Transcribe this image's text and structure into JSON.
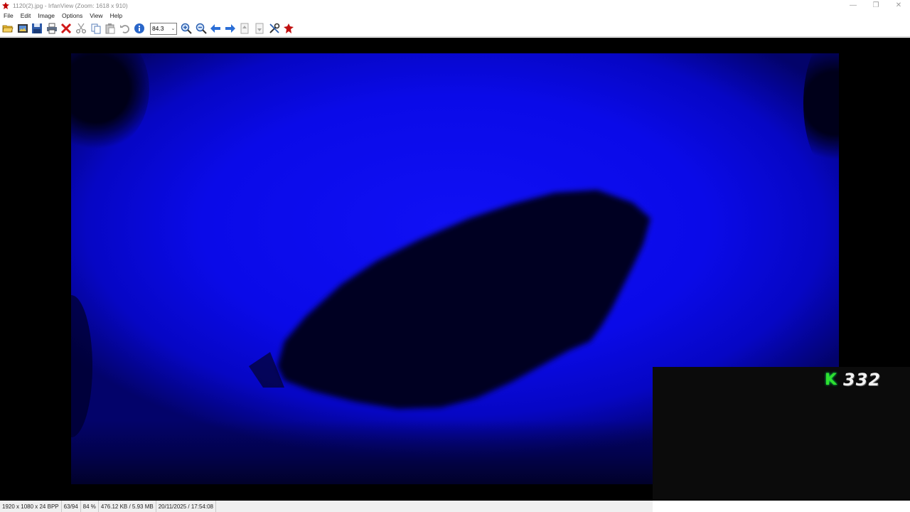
{
  "window": {
    "title": "1120(2).jpg - IrfanView (Zoom: 1618 x 910)",
    "minimize_glyph": "—",
    "restore_glyph": "❐",
    "close_glyph": "✕"
  },
  "menu": {
    "items": [
      {
        "label": "File"
      },
      {
        "label": "Edit"
      },
      {
        "label": "Image"
      },
      {
        "label": "Options"
      },
      {
        "label": "View"
      },
      {
        "label": "Help"
      }
    ]
  },
  "toolbar": {
    "zoom_value": "84.3",
    "zoom_arrow": "⌄",
    "icons": [
      "open-folder-icon",
      "slideshow-icon",
      "save-icon",
      "print-icon",
      "delete-icon",
      "cut-icon",
      "copy-icon",
      "paste-icon",
      "undo-icon",
      "info-icon",
      "zoom-in-icon",
      "zoom-out-icon",
      "previous-icon",
      "next-icon",
      "first-page-icon",
      "last-page-icon",
      "settings-icon",
      "exit-icon"
    ]
  },
  "overlay": {
    "prefix": "K",
    "number": "332"
  },
  "status": {
    "dimensions": "1920 x 1080 x 24 BPP",
    "index": "63/94",
    "zoom": "84 %",
    "size": "476.12 KB / 5.93 MB",
    "datetime": "20/11/2025 / 17:54:08"
  },
  "colors": {
    "photo_blue": "#0a0ae8",
    "overlay_green": "#2fe02f"
  }
}
